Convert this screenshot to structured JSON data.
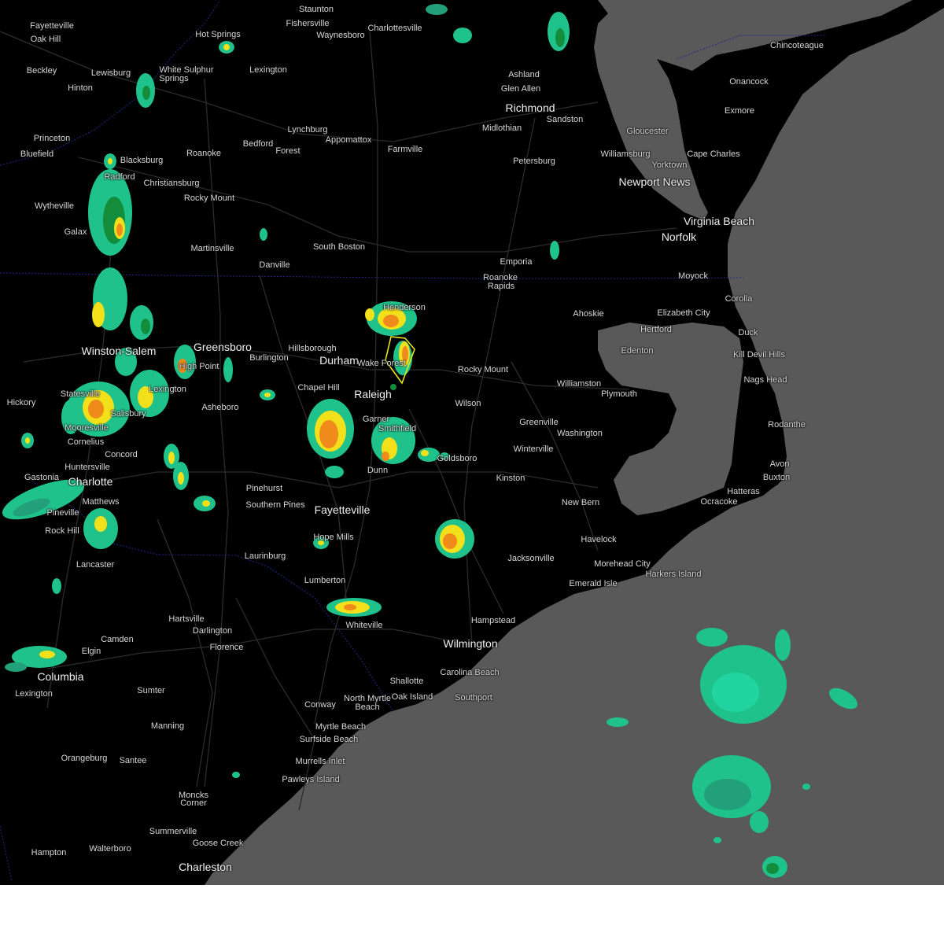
{
  "map": {
    "cities": [
      {
        "id": "staunton",
        "label": "Staunton",
        "major": false
      },
      {
        "id": "fishersville",
        "label": "Fishersville",
        "major": false
      },
      {
        "id": "waynesboro",
        "label": "Waynesboro",
        "major": false
      },
      {
        "id": "charlottesville",
        "label": "Charlottesville",
        "major": false
      },
      {
        "id": "fayetteville-wv",
        "label": "Fayetteville",
        "major": false
      },
      {
        "id": "oak-hill",
        "label": "Oak Hill",
        "major": false
      },
      {
        "id": "hot-springs",
        "label": "Hot Springs",
        "major": false
      },
      {
        "id": "chincoteague",
        "label": "Chincoteague",
        "major": false
      },
      {
        "id": "beckley",
        "label": "Beckley",
        "major": false
      },
      {
        "id": "lewisburg",
        "label": "Lewisburg",
        "major": false
      },
      {
        "id": "white-sulphur",
        "label": "White Sulphur",
        "major": false
      },
      {
        "id": "springs",
        "label": "Springs",
        "major": false
      },
      {
        "id": "lexington-va",
        "label": "Lexington",
        "major": false
      },
      {
        "id": "ashland",
        "label": "Ashland",
        "major": false
      },
      {
        "id": "hinton",
        "label": "Hinton",
        "major": false
      },
      {
        "id": "glen-allen",
        "label": "Glen Allen",
        "major": false
      },
      {
        "id": "onancock",
        "label": "Onancock",
        "major": false
      },
      {
        "id": "richmond",
        "label": "Richmond",
        "major": true
      },
      {
        "id": "exmore",
        "label": "Exmore",
        "major": false
      },
      {
        "id": "sandston",
        "label": "Sandston",
        "major": false
      },
      {
        "id": "midlothian",
        "label": "Midlothian",
        "major": false
      },
      {
        "id": "lynchburg",
        "label": "Lynchburg",
        "major": false
      },
      {
        "id": "gloucester",
        "label": "Gloucester",
        "major": false
      },
      {
        "id": "princeton",
        "label": "Princeton",
        "major": false
      },
      {
        "id": "appomattox",
        "label": "Appomattox",
        "major": false
      },
      {
        "id": "bedford",
        "label": "Bedford",
        "major": false
      },
      {
        "id": "forest",
        "label": "Forest",
        "major": false
      },
      {
        "id": "farmville",
        "label": "Farmville",
        "major": false
      },
      {
        "id": "bluefield",
        "label": "Bluefield",
        "major": false
      },
      {
        "id": "roanoke",
        "label": "Roanoke",
        "major": false
      },
      {
        "id": "williamsburg",
        "label": "Williamsburg",
        "major": false
      },
      {
        "id": "cape-charles",
        "label": "Cape Charles",
        "major": false
      },
      {
        "id": "blacksburg",
        "label": "Blacksburg",
        "major": false
      },
      {
        "id": "petersburg",
        "label": "Petersburg",
        "major": false
      },
      {
        "id": "yorktown",
        "label": "Yorktown",
        "major": false
      },
      {
        "id": "radford",
        "label": "Radford",
        "major": false
      },
      {
        "id": "christiansburg",
        "label": "Christiansburg",
        "major": false
      },
      {
        "id": "newport-news",
        "label": "Newport News",
        "major": true
      },
      {
        "id": "rocky-mount-va",
        "label": "Rocky Mount",
        "major": false
      },
      {
        "id": "wytheville",
        "label": "Wytheville",
        "major": false
      },
      {
        "id": "virginia-beach",
        "label": "Virginia Beach",
        "major": true
      },
      {
        "id": "norfolk",
        "label": "Norfolk",
        "major": true
      },
      {
        "id": "galax",
        "label": "Galax",
        "major": false
      },
      {
        "id": "south-boston",
        "label": "South Boston",
        "major": false
      },
      {
        "id": "martinsville",
        "label": "Martinsville",
        "major": false
      },
      {
        "id": "emporia",
        "label": "Emporia",
        "major": false
      },
      {
        "id": "danville",
        "label": "Danville",
        "major": false
      },
      {
        "id": "moyock",
        "label": "Moyock",
        "major": false
      },
      {
        "id": "roanoke-rapids-1",
        "label": "Roanoke",
        "major": false
      },
      {
        "id": "roanoke-rapids-2",
        "label": "Rapids",
        "major": false
      },
      {
        "id": "corolla",
        "label": "Corolla",
        "major": false
      },
      {
        "id": "henderson",
        "label": "Henderson",
        "major": false
      },
      {
        "id": "ahoskie",
        "label": "Ahoskie",
        "major": false
      },
      {
        "id": "elizabeth-city",
        "label": "Elizabeth City",
        "major": false
      },
      {
        "id": "hertford",
        "label": "Hertford",
        "major": false
      },
      {
        "id": "duck",
        "label": "Duck",
        "major": false
      },
      {
        "id": "winston-salem",
        "label": "Winston-Salem",
        "major": true
      },
      {
        "id": "greensboro",
        "label": "Greensboro",
        "major": true
      },
      {
        "id": "hillsborough",
        "label": "Hillsborough",
        "major": false
      },
      {
        "id": "edenton",
        "label": "Edenton",
        "major": false
      },
      {
        "id": "kill-devil-hills",
        "label": "Kill Devil Hills",
        "major": false
      },
      {
        "id": "high-point",
        "label": "High Point",
        "major": false
      },
      {
        "id": "burlington",
        "label": "Burlington",
        "major": false
      },
      {
        "id": "durham",
        "label": "Durham",
        "major": true
      },
      {
        "id": "wake-forest",
        "label": "Wake Forest",
        "major": false
      },
      {
        "id": "rocky-mount-nc",
        "label": "Rocky Mount",
        "major": false
      },
      {
        "id": "nags-head",
        "label": "Nags Head",
        "major": false
      },
      {
        "id": "williamston",
        "label": "Williamston",
        "major": false
      },
      {
        "id": "chapel-hill",
        "label": "Chapel Hill",
        "major": false
      },
      {
        "id": "plymouth",
        "label": "Plymouth",
        "major": false
      },
      {
        "id": "statesville",
        "label": "Statesville",
        "major": false
      },
      {
        "id": "raleigh",
        "label": "Raleigh",
        "major": true
      },
      {
        "id": "hickory",
        "label": "Hickory",
        "major": false
      },
      {
        "id": "lexington-nc",
        "label": "Lexington",
        "major": false
      },
      {
        "id": "asheboro",
        "label": "Asheboro",
        "major": false
      },
      {
        "id": "wilson",
        "label": "Wilson",
        "major": false
      },
      {
        "id": "salisbury",
        "label": "Salisbury",
        "major": false
      },
      {
        "id": "garner",
        "label": "Garner",
        "major": false
      },
      {
        "id": "rodanthe",
        "label": "Rodanthe",
        "major": false
      },
      {
        "id": "greenville",
        "label": "Greenville",
        "major": false
      },
      {
        "id": "mooresville",
        "label": "Mooresville",
        "major": false
      },
      {
        "id": "washington",
        "label": "Washington",
        "major": false
      },
      {
        "id": "cornelius",
        "label": "Cornelius",
        "major": false
      },
      {
        "id": "smithfield",
        "label": "Smithfield",
        "major": false
      },
      {
        "id": "winterville",
        "label": "Winterville",
        "major": false
      },
      {
        "id": "concord",
        "label": "Concord",
        "major": false
      },
      {
        "id": "goldsboro",
        "label": "Goldsboro",
        "major": false
      },
      {
        "id": "huntersville",
        "label": "Huntersville",
        "major": false
      },
      {
        "id": "avon",
        "label": "Avon",
        "major": false
      },
      {
        "id": "dunn",
        "label": "Dunn",
        "major": false
      },
      {
        "id": "gastonia",
        "label": "Gastonia",
        "major": false
      },
      {
        "id": "charlotte",
        "label": "Charlotte",
        "major": true
      },
      {
        "id": "buxton",
        "label": "Buxton",
        "major": false
      },
      {
        "id": "kinston",
        "label": "Kinston",
        "major": false
      },
      {
        "id": "pinehurst",
        "label": "Pinehurst",
        "major": false
      },
      {
        "id": "hatteras",
        "label": "Hatteras",
        "major": false
      },
      {
        "id": "matthews",
        "label": "Matthews",
        "major": false
      },
      {
        "id": "southern-pines",
        "label": "Southern Pines",
        "major": false
      },
      {
        "id": "new-bern",
        "label": "New Bern",
        "major": false
      },
      {
        "id": "ocracoke",
        "label": "Ocracoke",
        "major": false
      },
      {
        "id": "pineville",
        "label": "Pineville",
        "major": false
      },
      {
        "id": "fayetteville-nc",
        "label": "Fayetteville",
        "major": true
      },
      {
        "id": "rock-hill",
        "label": "Rock Hill",
        "major": false
      },
      {
        "id": "hope-mills",
        "label": "Hope Mills",
        "major": false
      },
      {
        "id": "havelock",
        "label": "Havelock",
        "major": false
      },
      {
        "id": "laurinburg",
        "label": "Laurinburg",
        "major": false
      },
      {
        "id": "jacksonville",
        "label": "Jacksonville",
        "major": false
      },
      {
        "id": "morehead-city",
        "label": "Morehead City",
        "major": false
      },
      {
        "id": "lancaster",
        "label": "Lancaster",
        "major": false
      },
      {
        "id": "harkers-island",
        "label": "Harkers Island",
        "major": false
      },
      {
        "id": "lumberton",
        "label": "Lumberton",
        "major": false
      },
      {
        "id": "emerald-isle",
        "label": "Emerald Isle",
        "major": false
      },
      {
        "id": "hartsville",
        "label": "Hartsville",
        "major": false
      },
      {
        "id": "hampstead",
        "label": "Hampstead",
        "major": false
      },
      {
        "id": "whiteville",
        "label": "Whiteville",
        "major": false
      },
      {
        "id": "darlington",
        "label": "Darlington",
        "major": false
      },
      {
        "id": "camden",
        "label": "Camden",
        "major": false
      },
      {
        "id": "wilmington",
        "label": "Wilmington",
        "major": true
      },
      {
        "id": "florence",
        "label": "Florence",
        "major": false
      },
      {
        "id": "elgin",
        "label": "Elgin",
        "major": false
      },
      {
        "id": "carolina-beach",
        "label": "Carolina Beach",
        "major": false
      },
      {
        "id": "columbia",
        "label": "Columbia",
        "major": true
      },
      {
        "id": "shallotte",
        "label": "Shallotte",
        "major": false
      },
      {
        "id": "sumter",
        "label": "Sumter",
        "major": false
      },
      {
        "id": "lexington-sc",
        "label": "Lexington",
        "major": false
      },
      {
        "id": "north-myrtle-1",
        "label": "North Myrtle",
        "major": false
      },
      {
        "id": "oak-island",
        "label": "Oak Island",
        "major": false
      },
      {
        "id": "southport",
        "label": "Southport",
        "major": false
      },
      {
        "id": "north-myrtle-2",
        "label": "Beach",
        "major": false
      },
      {
        "id": "conway",
        "label": "Conway",
        "major": false
      },
      {
        "id": "manning",
        "label": "Manning",
        "major": false
      },
      {
        "id": "myrtle-beach",
        "label": "Myrtle Beach",
        "major": false
      },
      {
        "id": "surfside-beach",
        "label": "Surfside Beach",
        "major": false
      },
      {
        "id": "orangeburg",
        "label": "Orangeburg",
        "major": false
      },
      {
        "id": "santee",
        "label": "Santee",
        "major": false
      },
      {
        "id": "murrells-inlet",
        "label": "Murrells Inlet",
        "major": false
      },
      {
        "id": "pawleys-island",
        "label": "Pawleys Island",
        "major": false
      },
      {
        "id": "moncks-corner-1",
        "label": "Moncks",
        "major": false
      },
      {
        "id": "moncks-corner-2",
        "label": "Corner",
        "major": false
      },
      {
        "id": "summerville",
        "label": "Summerville",
        "major": false
      },
      {
        "id": "goose-creek",
        "label": "Goose Creek",
        "major": false
      },
      {
        "id": "hampton",
        "label": "Hampton",
        "major": false
      },
      {
        "id": "walterboro",
        "label": "Walterboro",
        "major": false
      },
      {
        "id": "charleston",
        "label": "Charleston",
        "major": true
      }
    ],
    "colors": {
      "land": "#000000",
      "water": "#595959",
      "roads": "#2a2a2a",
      "state_border": "#1c2a8c",
      "radar_light": "#1fc28a",
      "radar_teal": "#21a07a",
      "radar_green": "#138c3c",
      "radar_yellow": "#f2e01a",
      "radar_orange": "#f08a1a",
      "radar_red": "#e43a1a",
      "warning_polygon": "#e6e61a"
    }
  }
}
